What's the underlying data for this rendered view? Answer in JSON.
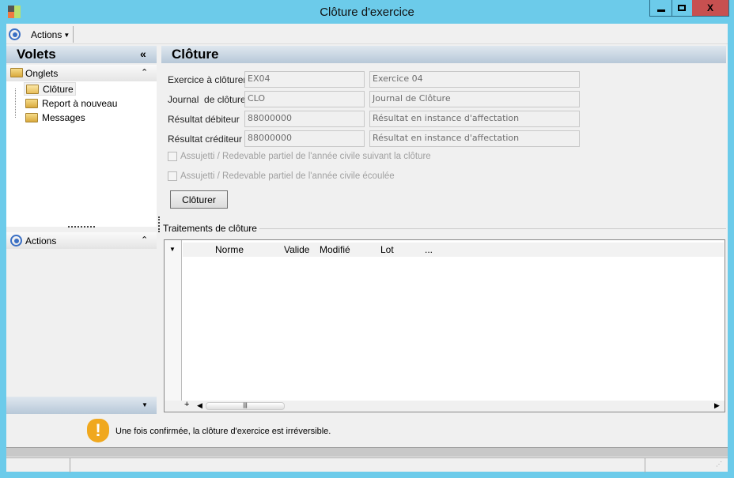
{
  "window": {
    "title": "Clôture d'exercice",
    "minimize": "▁",
    "maximize": "□",
    "close": "X"
  },
  "toolbar": {
    "actions_label": "Actions"
  },
  "left_panel": {
    "title": "Volets",
    "collapse": "«",
    "onglets": {
      "label": "Onglets",
      "items": [
        {
          "label": "Clôture"
        },
        {
          "label": "Report à nouveau"
        },
        {
          "label": "Messages"
        }
      ]
    },
    "actions": {
      "label": "Actions"
    }
  },
  "main": {
    "title": "Clôture",
    "form": [
      {
        "label": "Exercice à clôturer",
        "code": "EX04",
        "description": "Exercice 04"
      },
      {
        "label": "Journal  de clôture",
        "code": "CLO",
        "description": "Journal de Clôture"
      },
      {
        "label": "Résultat débiteur",
        "code": "88000000",
        "description": "Résultat en instance d'affectation"
      },
      {
        "label": "Résultat créditeur",
        "code": "88000000",
        "description": "Résultat en instance d'affectation"
      }
    ],
    "checkboxes": [
      {
        "label": "Assujetti / Redevable partiel de l'année civile suivant la clôture",
        "checked": false
      },
      {
        "label": "Assujetti / Redevable partiel de l'année civile écoulée",
        "checked": false
      }
    ],
    "button": "Clôturer",
    "group_title": "Traitements de clôture",
    "grid": {
      "columns": [
        "Norme",
        "Valide",
        "Modifié",
        "Lot",
        "..."
      ],
      "add": "+"
    }
  },
  "warning": {
    "text": "Une fois confirmée, la clôture d'exercice est irréversible.",
    "color": "#f0a81e"
  }
}
